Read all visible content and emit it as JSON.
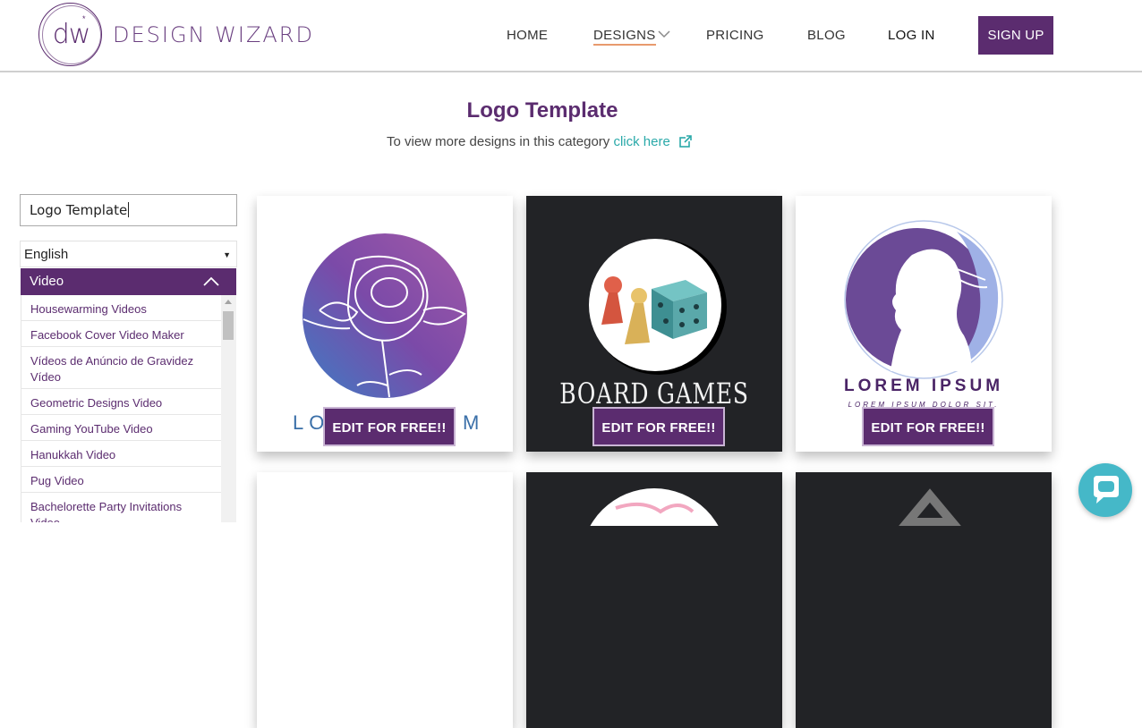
{
  "brand": {
    "logo_text": "dw",
    "name": "DESIGN WIZARD"
  },
  "nav": {
    "home": "HOME",
    "designs": "DESIGNS",
    "pricing": "PRICING",
    "blog": "BLOG",
    "login": "LOG IN",
    "signup": "SIGN UP"
  },
  "page": {
    "title": "Logo Template",
    "subtitle_prefix": "To view more designs in this category ",
    "subtitle_link": "click here"
  },
  "sidebar": {
    "search_value": "Logo Template",
    "language": "English",
    "category_header": "Video",
    "categories": [
      "Housewarming Videos",
      "Facebook Cover Video Maker",
      "Vídeos de Anúncio de Gravidez Vídeo",
      "Geometric Designs Video",
      "Gaming YouTube Video",
      "Hanukkah Video",
      "Pug Video",
      "Bachelorette Party Invitations Video"
    ]
  },
  "cards": {
    "edit_label": "EDIT FOR FREE!!",
    "card1_text_left": "LO",
    "card1_text_right": "M",
    "card2_text": "BOARD GAMES",
    "card3_title": "LOREM IPSUM",
    "card3_sub": "LOREM IPSUM DOLOR SIT."
  },
  "colors": {
    "brand_purple": "#5b2c6f",
    "link_teal": "#2aa9a9",
    "chat_teal": "#45b8c8"
  },
  "icons": {
    "designs_dropdown": "chevron-down-icon",
    "external_link": "external-link-icon",
    "category_collapse": "chevron-up-icon",
    "chat": "chat-bubble-icon"
  }
}
